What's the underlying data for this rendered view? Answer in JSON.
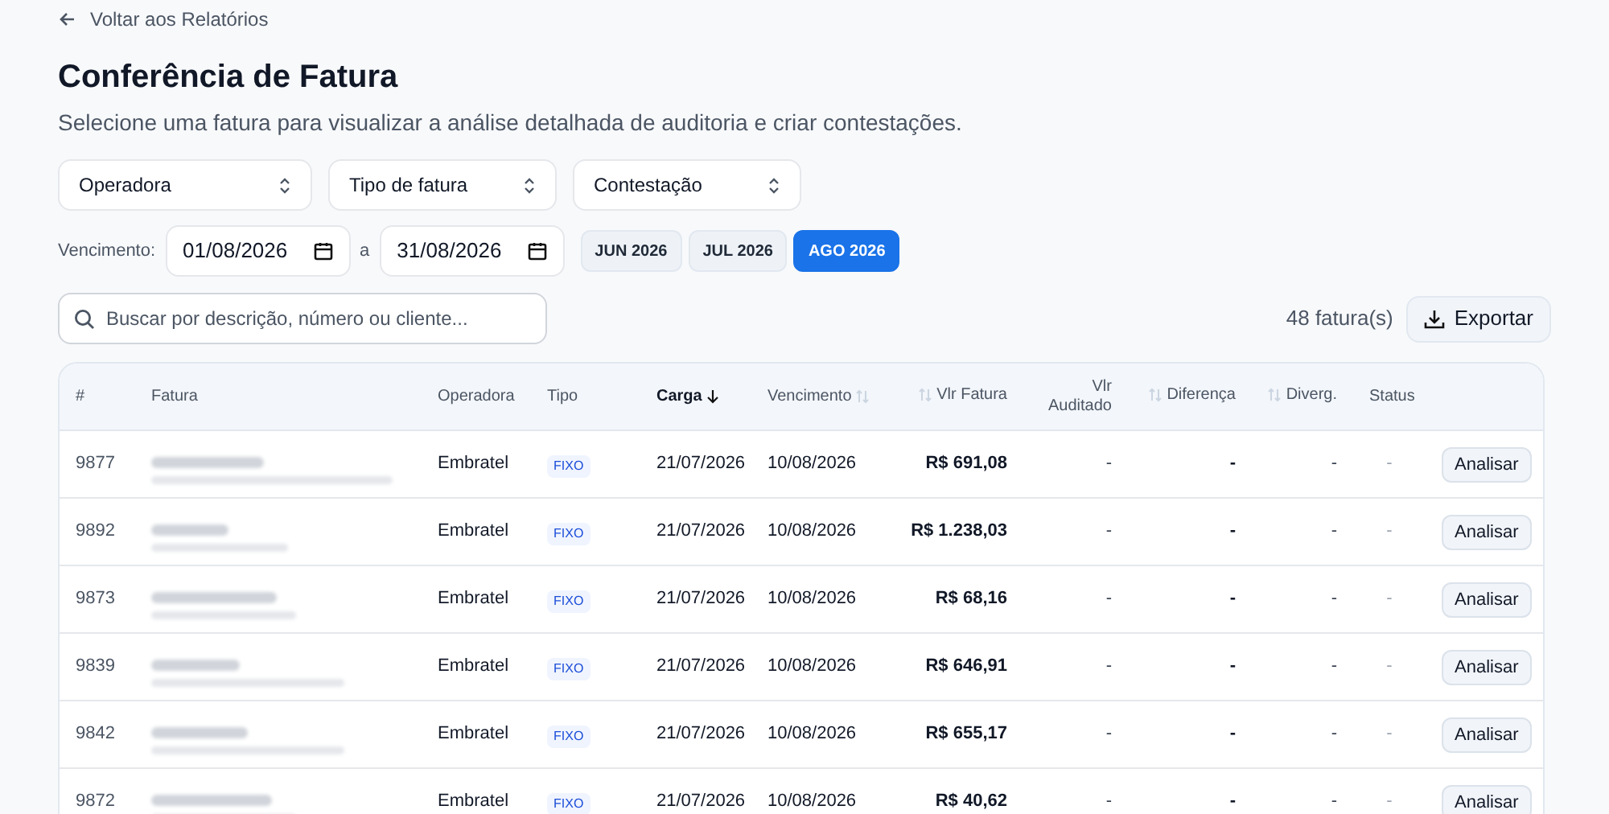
{
  "back_link": {
    "label": "Voltar aos Relatórios"
  },
  "title": "Conferência de Fatura",
  "subtitle": "Selecione uma fatura para visualizar a análise detalhada de auditoria e criar contestações.",
  "selects": [
    {
      "label": "Operadora"
    },
    {
      "label": "Tipo de fatura"
    },
    {
      "label": "Contestação"
    }
  ],
  "due_filter": {
    "label": "Vencimento:",
    "from": "01/08/2026",
    "separator": "a",
    "to": "31/08/2026"
  },
  "months": [
    {
      "label": "JUN 2026",
      "selected": false
    },
    {
      "label": "JUL 2026",
      "selected": false
    },
    {
      "label": "AGO 2026",
      "selected": true
    }
  ],
  "search": {
    "placeholder": "Buscar por descrição, número ou cliente..."
  },
  "count": "48 fatura(s)",
  "export_button": "Exportar",
  "table": {
    "columns": [
      {
        "label": "#",
        "sortable": false,
        "sorted": false
      },
      {
        "label": "Fatura",
        "sortable": false,
        "sorted": false
      },
      {
        "label": "Operadora",
        "sortable": false,
        "sorted": false
      },
      {
        "label": "Tipo",
        "sortable": false,
        "sorted": false
      },
      {
        "label": "Carga",
        "sortable": true,
        "sorted": true
      },
      {
        "label": "Vencimento",
        "sortable": true,
        "sorted": false
      },
      {
        "label": "Vlr Fatura",
        "sortable": true,
        "sorted": false
      },
      {
        "label": "Vlr Auditado",
        "sortable": false,
        "sorted": false
      },
      {
        "label": "Diferença",
        "sortable": true,
        "sorted": false
      },
      {
        "label": "Diverg.",
        "sortable": true,
        "sorted": false
      },
      {
        "label": "Status",
        "sortable": false,
        "sorted": false
      }
    ],
    "rows": [
      {
        "id": "9877",
        "operator": "Embratel",
        "type": "FIXO",
        "load_date": "21/07/2026",
        "due_date": "10/08/2026",
        "invoice_value": "R$ 691,08",
        "audited_value": "-",
        "difference": "-",
        "divergences": "-",
        "status": "-",
        "action": "Analisar"
      },
      {
        "id": "9892",
        "operator": "Embratel",
        "type": "FIXO",
        "load_date": "21/07/2026",
        "due_date": "10/08/2026",
        "invoice_value": "R$ 1.238,03",
        "audited_value": "-",
        "difference": "-",
        "divergences": "-",
        "status": "-",
        "action": "Analisar"
      },
      {
        "id": "9873",
        "operator": "Embratel",
        "type": "FIXO",
        "load_date": "21/07/2026",
        "due_date": "10/08/2026",
        "invoice_value": "R$ 68,16",
        "audited_value": "-",
        "difference": "-",
        "divergences": "-",
        "status": "-",
        "action": "Analisar"
      },
      {
        "id": "9839",
        "operator": "Embratel",
        "type": "FIXO",
        "load_date": "21/07/2026",
        "due_date": "10/08/2026",
        "invoice_value": "R$ 646,91",
        "audited_value": "-",
        "difference": "-",
        "divergences": "-",
        "status": "-",
        "action": "Analisar"
      },
      {
        "id": "9842",
        "operator": "Embratel",
        "type": "FIXO",
        "load_date": "21/07/2026",
        "due_date": "10/08/2026",
        "invoice_value": "R$ 655,17",
        "audited_value": "-",
        "difference": "-",
        "divergences": "-",
        "status": "-",
        "action": "Analisar"
      },
      {
        "id": "9872",
        "operator": "Embratel",
        "type": "FIXO",
        "load_date": "21/07/2026",
        "due_date": "10/08/2026",
        "invoice_value": "R$ 40,62",
        "audited_value": "-",
        "difference": "-",
        "divergences": "-",
        "status": "-",
        "action": "Analisar"
      }
    ]
  }
}
